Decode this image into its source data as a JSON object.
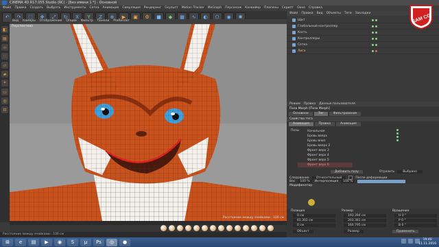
{
  "window": {
    "title": "CINEMA 4D R17.055 Studio (RC) - [Без имени 1 *] - Основной"
  },
  "menubar": {
    "items": [
      "Файл",
      "Правка",
      "Создать",
      "Выбрать",
      "Инструменты",
      "Сетка",
      "Анимация",
      "Симуляция",
      "Рендеринг",
      "Скульпт",
      "Motion Tracker",
      "MoGraph",
      "Персонаж",
      "Конвейер",
      "Плагины",
      "Скрипт",
      "Окно",
      "Справка"
    ]
  },
  "viewport": {
    "menu": [
      "Вид",
      "Камеры",
      "Отображение",
      "Опции",
      "Фильтр",
      "Панели",
      "ProRender"
    ],
    "label": "Перспектива",
    "status": "Расстояние между ячейками : 100 см"
  },
  "objects": {
    "menu": [
      "Файл",
      "Правка",
      "Вид",
      "Объекты",
      "Теги",
      "Закладки"
    ],
    "rows": [
      {
        "name": "Щит"
      },
      {
        "name": "Глобальный контроллер"
      },
      {
        "name": "Кость"
      },
      {
        "name": "Контроллеры"
      },
      {
        "name": "Сетка"
      },
      {
        "name": "Лиса",
        "selected": true
      }
    ]
  },
  "attributes": {
    "menu": [
      "Режим",
      "Правка",
      "Данные пользователя"
    ],
    "object_name": "Поза Morph [Поза Morph]",
    "tabs": [
      "Основное",
      "Тег",
      "Фильтрование"
    ],
    "section": "Свойства тега",
    "subtabs": [
      "Анимация",
      "Правка",
      "Анимация"
    ],
    "pose_label": "Позы",
    "poses": [
      "Начальная",
      "Бровь вверх",
      "Бровь вниз",
      "Бровь вверх 2",
      "Фронт верх 3",
      "Фронт верх 4",
      "Фронт верх 5",
      "Фронт верх 6"
    ],
    "selected_pose": "Фронт верх 6",
    "add_pose": "Добавить позу",
    "mode_label": "Отразить",
    "mode_value": "Выбрано",
    "relative_label": "Следование",
    "relative_value": "Относительный",
    "deform_label": "После деформации",
    "strength_label": "Вес",
    "strength_value": "100 %",
    "interp_label": "Интерполяция",
    "interp_value": "100 %",
    "morph_title": "Модификатор"
  },
  "coordinates": {
    "headers": [
      "Позиция",
      "Размер",
      "Вращение"
    ],
    "rows": [
      {
        "axis": "X",
        "pos": "0 см",
        "size": "193.394 см",
        "rot": "H 0 °"
      },
      {
        "axis": "Y",
        "pos": "81.302 см",
        "size": "203.381 см",
        "rot": "P 0 °"
      },
      {
        "axis": "Z",
        "pos": "0 см",
        "size": "160.795 см",
        "rot": "B 0 °"
      }
    ],
    "mode": "Объект",
    "size_mode": "Размер",
    "apply": "Применить"
  },
  "taskbar": {
    "time": "19:40",
    "date": "11.11.2016"
  },
  "logo": {
    "text": "SAM CG"
  },
  "colors": {
    "accent": "#f3a53b",
    "selection": "#f09080",
    "fox_orange": "#c8511c"
  }
}
